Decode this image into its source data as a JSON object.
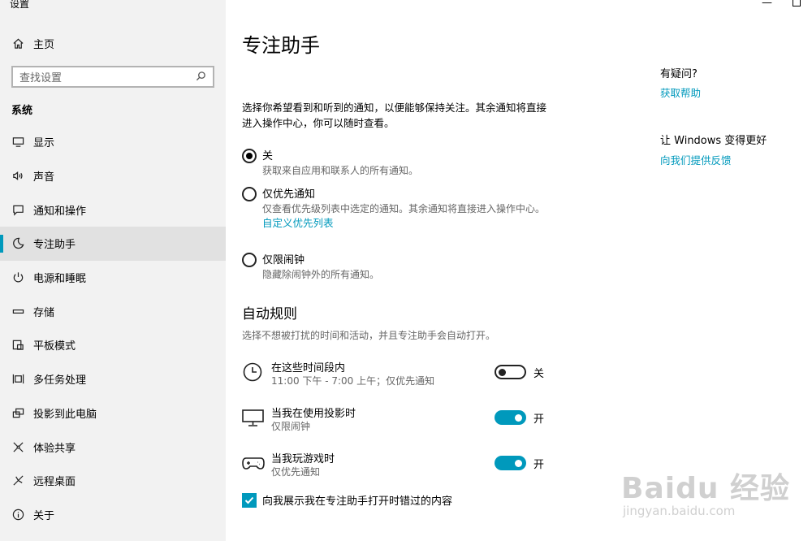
{
  "window": {
    "title": "设置",
    "minimize": "—"
  },
  "sidebar": {
    "home_label": "主页",
    "search_placeholder": "查找设置",
    "section": "系统",
    "items": [
      {
        "label": "显示",
        "icon": "monitor-icon"
      },
      {
        "label": "声音",
        "icon": "speaker-icon"
      },
      {
        "label": "通知和操作",
        "icon": "notification-icon"
      },
      {
        "label": "专注助手",
        "icon": "moon-icon",
        "active": true
      },
      {
        "label": "电源和睡眠",
        "icon": "power-icon"
      },
      {
        "label": "存储",
        "icon": "storage-icon"
      },
      {
        "label": "平板模式",
        "icon": "tablet-icon"
      },
      {
        "label": "多任务处理",
        "icon": "multitask-icon"
      },
      {
        "label": "投影到此电脑",
        "icon": "project-icon"
      },
      {
        "label": "体验共享",
        "icon": "share-icon"
      },
      {
        "label": "远程桌面",
        "icon": "remote-icon"
      },
      {
        "label": "关于",
        "icon": "info-icon"
      }
    ]
  },
  "main": {
    "title": "专注助手",
    "description": "选择你希望看到和听到的通知，以便能够保持关注。其余通知将直接进入操作中心，你可以随时查看。",
    "options": [
      {
        "label": "关",
        "desc": "获取来自应用和联系人的所有通知。",
        "checked": true
      },
      {
        "label": "仅优先通知",
        "desc": "仅查看优先级列表中选定的通知。其余通知将直接进入操作中心。",
        "link": "自定义优先列表",
        "checked": false
      },
      {
        "label": "仅限闹钟",
        "desc": "隐藏除闹钟外的所有通知。",
        "checked": false
      }
    ],
    "auto_rules_title": "自动规则",
    "auto_rules_desc": "选择不想被打扰的时间和活动，并且专注助手会自动打开。",
    "rules": [
      {
        "title": "在这些时间段内",
        "sub": "11:00 下午 - 7:00 上午；仅优先通知",
        "state": "关",
        "on": false,
        "icon": "clock-icon"
      },
      {
        "title": "当我在使用投影时",
        "sub": "仅限闹钟",
        "state": "开",
        "on": true,
        "icon": "display-icon"
      },
      {
        "title": "当我玩游戏时",
        "sub": "仅优先通知",
        "state": "开",
        "on": true,
        "icon": "gamepad-icon"
      }
    ],
    "checkbox_label": "向我展示我在专注助手打开时错过的内容"
  },
  "right": {
    "help_head": "有疑问?",
    "help_link": "获取帮助",
    "feedback_head": "让 Windows 变得更好",
    "feedback_link": "向我们提供反馈"
  },
  "watermark": {
    "main": "Baidu 经验",
    "sub": "jingyan.baidu.com"
  },
  "colors": {
    "accent": "#0099bc",
    "sidebar_bg": "#f2f2f2",
    "active_bg": "#e1e1e1"
  }
}
